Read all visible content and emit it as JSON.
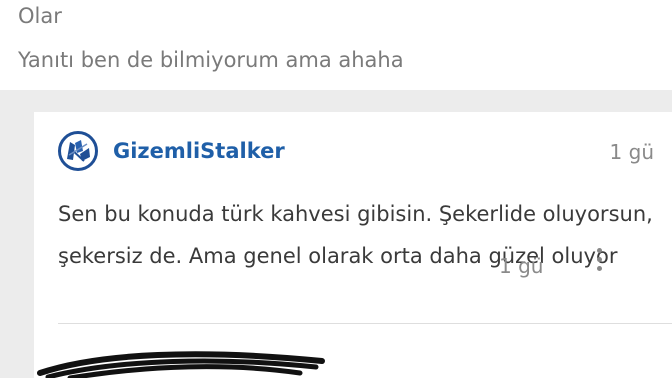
{
  "previous_comment": {
    "line1": "Olar",
    "line2": "Yanıtı ben de bilmiyorum ama ahaha"
  },
  "reply": {
    "username": "GizemliStalker",
    "time": "1 gü",
    "body": "Sen bu konuda türk kahvesi gibisin. Şekerlide oluyorsun, şekersiz de. Ama genel olarak orta daha güzel oluyor",
    "avatar_icon": "avatar-badge-icon"
  },
  "next_reply": {
    "time": "1 gü",
    "menu_icon": "kebab-menu-icon",
    "redaction_icon": "scribble-redaction-icon"
  },
  "colors": {
    "username": "#1f5fa8",
    "text": "#3a3a3a",
    "muted": "#8a8a8a",
    "background": "#ececec",
    "card": "#ffffff"
  }
}
